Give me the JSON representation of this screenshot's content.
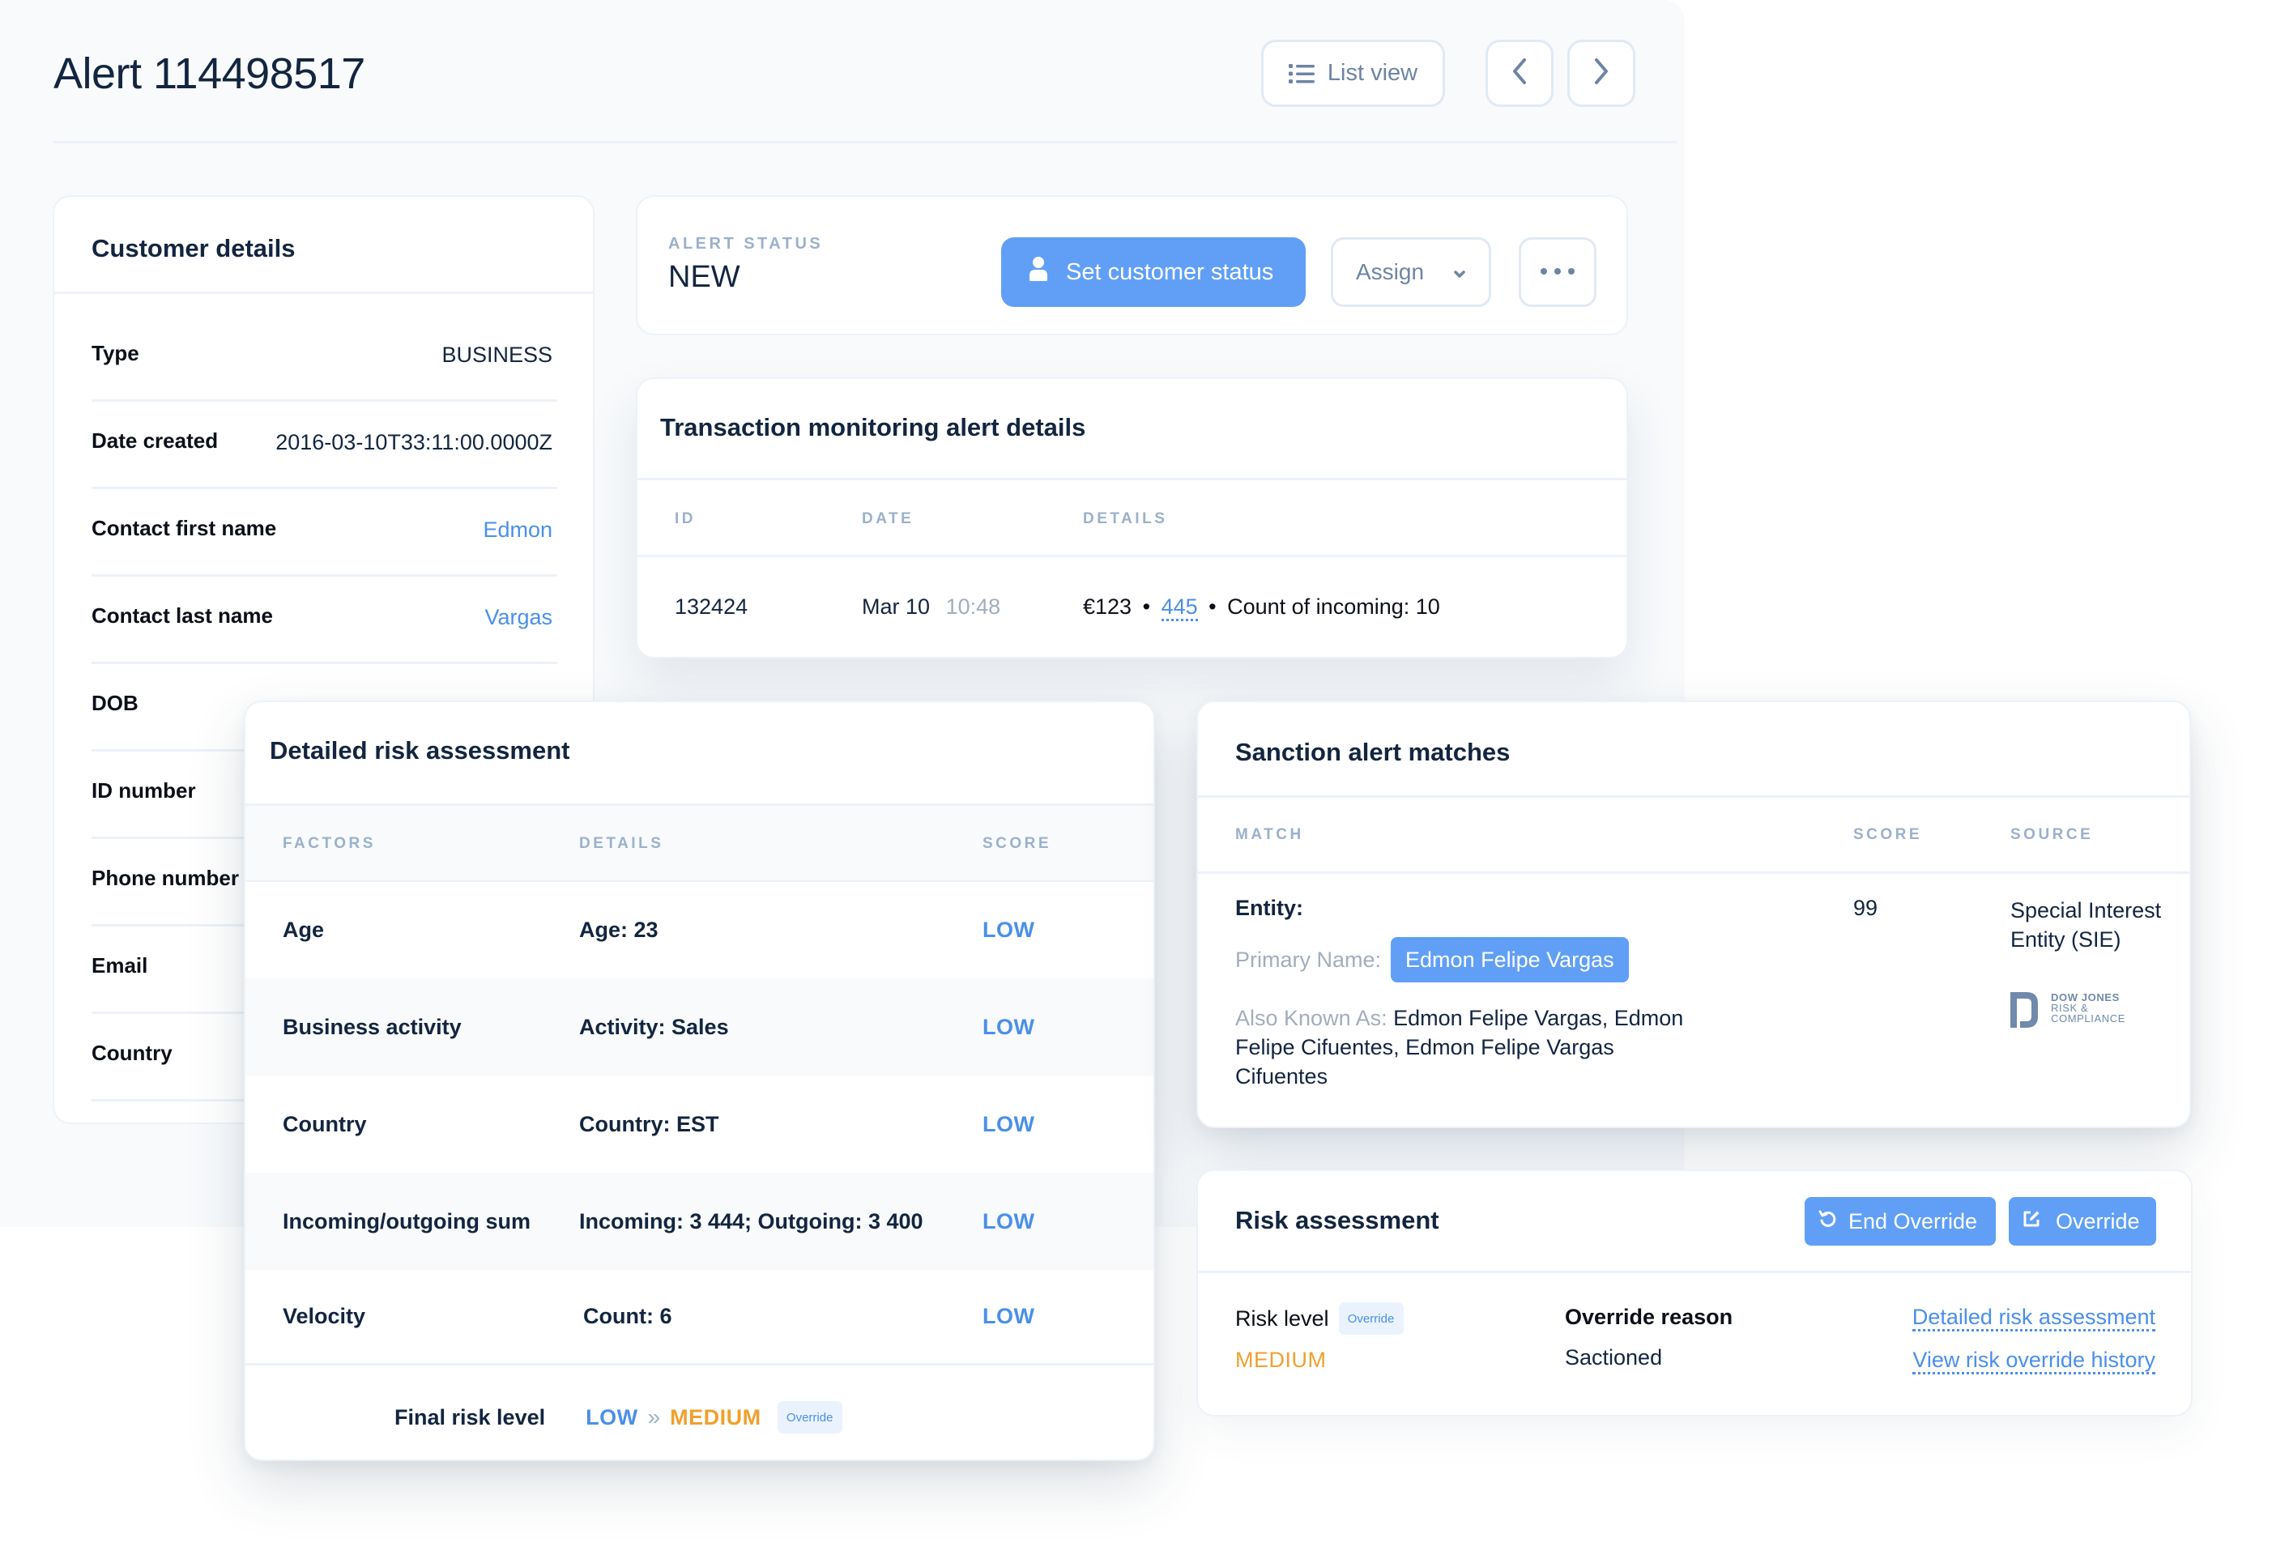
{
  "header": {
    "title": "Alert 114498517",
    "list_view_label": "List view",
    "prev_icon": "chevron-left-icon",
    "next_icon": "chevron-right-icon"
  },
  "customer_details": {
    "title": "Customer details",
    "rows": [
      {
        "label": "Type",
        "value": "BUSINESS",
        "link": false
      },
      {
        "label": "Date created",
        "value": "2016-03-10T33:11:00.0000Z",
        "link": false
      },
      {
        "label": "Contact first name",
        "value": "Edmon",
        "link": true
      },
      {
        "label": "Contact last name",
        "value": "Vargas",
        "link": true
      },
      {
        "label": "DOB",
        "value": "",
        "link": false
      },
      {
        "label": "ID number",
        "value": "",
        "link": false
      },
      {
        "label": "Phone number",
        "value": "",
        "link": false
      },
      {
        "label": "Email",
        "value": "",
        "link": false
      },
      {
        "label": "Country",
        "value": "",
        "link": false
      }
    ]
  },
  "alert_status": {
    "label": "ALERT STATUS",
    "value": "NEW",
    "set_status_label": "Set customer status",
    "assign_label": "Assign",
    "more_icon": "more-horizontal-icon"
  },
  "transaction": {
    "title": "Transaction monitoring alert details",
    "columns": [
      "ID",
      "DATE",
      "DETAILS"
    ],
    "row": {
      "id": "132424",
      "date": "Mar 10",
      "time": "10:48",
      "amount": "€123",
      "link_value": "445",
      "details_suffix": "Count of incoming: 10",
      "separator": "•"
    }
  },
  "detailed_risk": {
    "title": "Detailed risk assessment",
    "columns": [
      "FACTORS",
      "DETAILS",
      "SCORE"
    ],
    "rows": [
      {
        "factor": "Age",
        "details": "Age: 23",
        "score": "LOW"
      },
      {
        "factor": "Business activity",
        "details": "Activity: Sales",
        "score": "LOW"
      },
      {
        "factor": "Country",
        "details": "Country: EST",
        "score": "LOW"
      },
      {
        "factor": "Incoming/outgoing sum",
        "details": "Incoming: 3 444; Outgoing: 3 400",
        "score": "LOW"
      },
      {
        "factor": "Velocity",
        "details": "Count: 6",
        "score": "LOW"
      }
    ],
    "final_label": "Final risk level",
    "final_from": "LOW",
    "final_arrow": "»",
    "final_to": "MEDIUM",
    "final_badge": "Override"
  },
  "sanction": {
    "title": "Sanction alert matches",
    "columns": [
      "MATCH",
      "SCORE",
      "SOURCE"
    ],
    "match": {
      "entity_label": "Entity:",
      "primary_label": "Primary Name:",
      "primary_name": "Edmon Felipe Vargas",
      "aka_label": "Also Known As:",
      "aka_lines": [
        "Edmon Felipe Vargas, Edmon",
        "Felipe Cifuentes, Edmon Felipe Vargas",
        "Cifuentes"
      ],
      "score": "99",
      "source_lines": [
        "Special Interest",
        "Entity (SIE)"
      ],
      "source_logo_lines": [
        "DOW JONES",
        "RISK &",
        "COMPLIANCE"
      ]
    }
  },
  "risk_assessment": {
    "title": "Risk assessment",
    "end_override_label": "End Override",
    "override_label": "Override",
    "risk_level_label": "Risk level",
    "risk_level_badge": "Override",
    "risk_level_value": "MEDIUM",
    "override_reason_label": "Override reason",
    "override_reason_value": "Sactioned",
    "link_detailed": "Detailed risk assessment",
    "link_history": "View risk override history"
  },
  "colors": {
    "primary_blue": "#609ff5",
    "link_blue": "#4a8fe9",
    "medium_orange": "#f0a02e",
    "text_dark": "#13253f",
    "muted_label": "#9bb0cb"
  }
}
